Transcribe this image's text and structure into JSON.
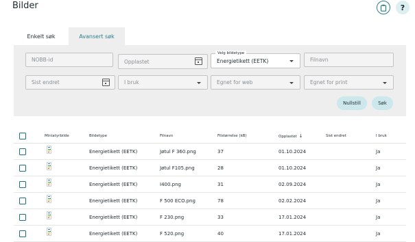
{
  "page": {
    "title": "Bilder"
  },
  "header": {
    "clipboard_icon": "clipboard-icon",
    "help_label": "?"
  },
  "tabs": [
    {
      "label": "Enkelt søk",
      "active": false
    },
    {
      "label": "Avansert søk",
      "active": true
    }
  ],
  "search": {
    "nobb_id": {
      "placeholder": "NOBB-id",
      "value": ""
    },
    "uploaded": {
      "placeholder": "Opplastet",
      "value": ""
    },
    "image_type": {
      "label": "Velg bildetype",
      "value": "Energietikett (EETK)"
    },
    "filename": {
      "placeholder": "Filnavn",
      "value": ""
    },
    "last_changed": {
      "placeholder": "Sist endret",
      "value": ""
    },
    "in_use": {
      "placeholder": "I bruk",
      "value": ""
    },
    "web": {
      "placeholder": "Egnet for web",
      "value": ""
    },
    "print": {
      "placeholder": "Egnet for print",
      "value": ""
    },
    "reset_label": "Nullstill",
    "search_label": "Søk"
  },
  "table": {
    "columns": {
      "thumbnail": "Miniatyrbilde",
      "image_type": "Bildetype",
      "filename": "Filnavn",
      "filesize": "Filstørrelse (kB)",
      "uploaded": "Opplastet",
      "last_changed": "Sist endret",
      "in_use": "I bruk"
    },
    "sort_icon": "arrow-down-icon",
    "rows": [
      {
        "image_type": "Energietikett (EETK)",
        "filename": "Jøtul F 360.png",
        "filesize": "37",
        "uploaded": "01.10.2024",
        "last_changed": "",
        "in_use": "Ja"
      },
      {
        "image_type": "Energietikett (EETK)",
        "filename": "Jøtul F105.png",
        "filesize": "28",
        "uploaded": "01.10.2024",
        "last_changed": "",
        "in_use": "Ja"
      },
      {
        "image_type": "Energietikett (EETK)",
        "filename": "I400.png",
        "filesize": "31",
        "uploaded": "02.09.2024",
        "last_changed": "",
        "in_use": "Ja"
      },
      {
        "image_type": "Energietikett (EETK)",
        "filename": "F 500 ECO.png",
        "filesize": "78",
        "uploaded": "02.02.2024",
        "last_changed": "",
        "in_use": "Ja"
      },
      {
        "image_type": "Energietikett (EETK)",
        "filename": "F 230.png",
        "filesize": "33",
        "uploaded": "17.01.2024",
        "last_changed": "",
        "in_use": "Ja"
      },
      {
        "image_type": "Energietikett (EETK)",
        "filename": "F 520.png",
        "filesize": "40",
        "uploaded": "17.01.2024",
        "last_changed": "",
        "in_use": "Ja"
      }
    ]
  },
  "colors": {
    "accent": "#2a7f8c",
    "panel": "#eeeeee",
    "pill": "#cde8ec"
  }
}
